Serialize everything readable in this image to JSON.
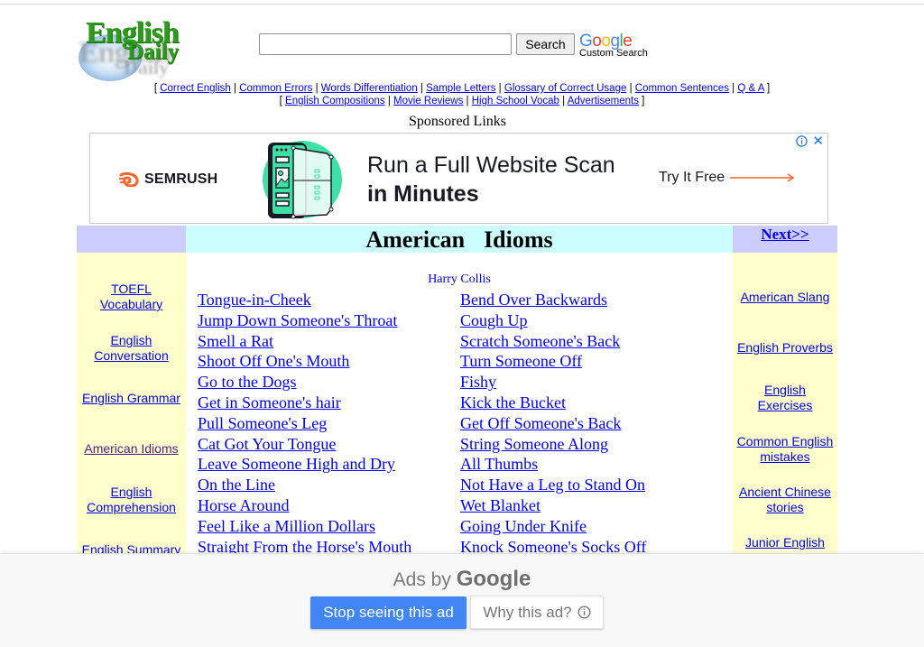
{
  "header": {
    "logo": {
      "line1": "English",
      "line2": "Daily"
    },
    "search": {
      "value": "",
      "placeholder": "",
      "button_label": "Search"
    },
    "google_brand": {
      "letters": [
        "G",
        "o",
        "o",
        "g",
        "l",
        "e"
      ],
      "colors": [
        "#4285f4",
        "#ea4335",
        "#fbbc05",
        "#4285f4",
        "#34a853",
        "#ea4335"
      ],
      "subtitle": "Custom Search"
    }
  },
  "nav": {
    "row1": [
      "Correct English",
      "Common Errors",
      "Words Differentiation",
      "Sample Letters",
      "Glossary of Correct Usage",
      "Common Sentences",
      "Q & A"
    ],
    "row2": [
      "English Compositions",
      "Movie Reviews",
      "High School Vocab",
      "Advertisements"
    ],
    "open_bracket": "[ ",
    "close_bracket": " ]",
    "separator": " | "
  },
  "sponsored_label": "Sponsored Links",
  "ad_banner": {
    "brand": "SEMRUSH",
    "headline_line1": "Run a Full Website Scan",
    "headline_line2": "in Minutes",
    "cta": "Try It Free",
    "info_icon": "info-icon",
    "close_icon": "close-icon",
    "colors": {
      "brand_orange": "#ff642d",
      "illustration_green": "#3fe0a5",
      "text": "#171a22"
    }
  },
  "main": {
    "title": "American  Idioms",
    "next_link": "Next>>",
    "author": "Harry Collis",
    "idioms_col1": [
      "Tongue-in-Cheek",
      "Jump Down Someone's Throat",
      "Smell a Rat",
      "Shoot Off One's Mouth",
      "Go to the Dogs",
      "Get in Someone's hair",
      "Pull Someone's Leg",
      "Cat Got Your Tongue",
      "Leave Someone High and Dry",
      "On the Line",
      "Horse Around",
      "Feel Like a Million Dollars",
      "Straight From the Horse's Mouth"
    ],
    "idioms_col2": [
      "Bend Over Backwards",
      "Cough Up",
      "Scratch Someone's Back",
      "Turn Someone Off",
      "Fishy",
      "Kick the Bucket",
      "Get Off Someone's Back",
      "String Someone Along",
      "All Thumbs",
      "Not Have a Leg to Stand On",
      "Wet Blanket",
      "Going Under Knife",
      "Knock Someone's Socks Off"
    ]
  },
  "left_sidebar": [
    {
      "label": "TOEFL Vocabulary",
      "lines": [
        "TOEFL",
        "Vocabulary"
      ],
      "visited": false
    },
    {
      "label": "English Conversation",
      "lines": [
        "English",
        "Conversation"
      ],
      "visited": false
    },
    {
      "label": "English Grammar",
      "lines": [
        "English Grammar"
      ],
      "visited": false
    },
    {
      "label": "American Idioms",
      "lines": [
        "American Idioms"
      ],
      "visited": true
    },
    {
      "label": "English Comprehension",
      "lines": [
        "English",
        "Comprehension"
      ],
      "visited": false
    },
    {
      "label": "English Summary",
      "lines": [
        "English Summary"
      ],
      "visited": false
    }
  ],
  "right_sidebar": [
    {
      "label": "American Slang",
      "lines": [
        "American Slang"
      ]
    },
    {
      "label": "English Proverbs",
      "lines": [
        "English Proverbs"
      ]
    },
    {
      "label": "English Exercises",
      "lines": [
        "English",
        "Exercises"
      ]
    },
    {
      "label": "Common English mistakes",
      "lines": [
        "Common English",
        "mistakes"
      ]
    },
    {
      "label": "Ancient Chinese stories",
      "lines": [
        "Ancient Chinese",
        "stories"
      ]
    },
    {
      "label": "Junior English",
      "lines": [
        "Junior English"
      ]
    }
  ],
  "ad_overlay": {
    "ads_by": "Ads by",
    "google": "Google",
    "stop_button": "Stop seeing this ad",
    "why_button": "Why this ad?",
    "colors": {
      "stop_bg": "#4285f4"
    }
  }
}
